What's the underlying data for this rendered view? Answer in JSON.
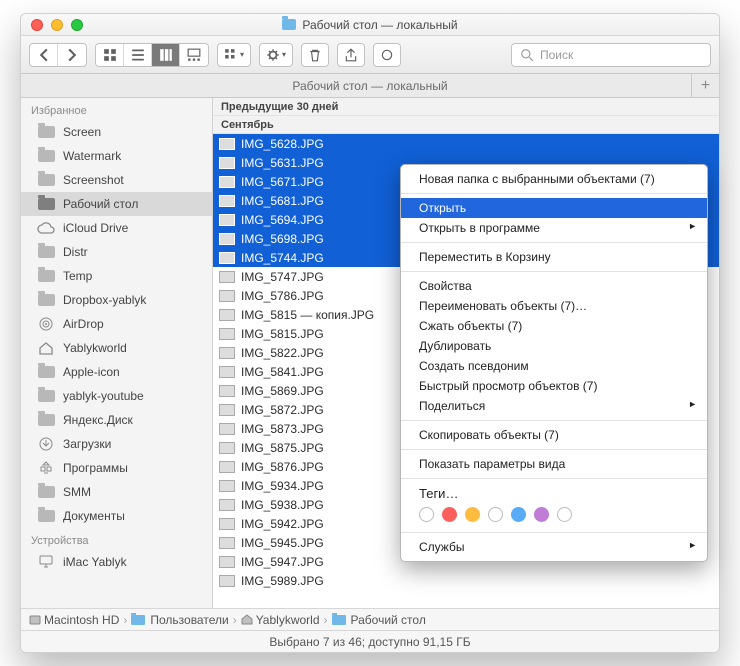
{
  "window": {
    "title": "Рабочий стол — локальный"
  },
  "toolbar": {
    "search_placeholder": "Поиск"
  },
  "tab": {
    "label": "Рабочий стол — локальный"
  },
  "sidebar": {
    "sections": [
      {
        "title": "Избранное",
        "items": [
          {
            "label": "Screen",
            "icon": "folder"
          },
          {
            "label": "Watermark",
            "icon": "folder"
          },
          {
            "label": "Screenshot",
            "icon": "folder"
          },
          {
            "label": "Рабочий стол",
            "icon": "folder-dark",
            "selected": true
          },
          {
            "label": "iCloud Drive",
            "icon": "cloud"
          },
          {
            "label": "Distr",
            "icon": "folder"
          },
          {
            "label": "Temp",
            "icon": "folder"
          },
          {
            "label": "Dropbox-yablyk",
            "icon": "folder"
          },
          {
            "label": "AirDrop",
            "icon": "airdrop"
          },
          {
            "label": "Yablykworld",
            "icon": "home"
          },
          {
            "label": "Apple-icon",
            "icon": "folder"
          },
          {
            "label": "yablyk-youtube",
            "icon": "folder"
          },
          {
            "label": "Яндекс.Диск",
            "icon": "folder"
          },
          {
            "label": "Загрузки",
            "icon": "downloads"
          },
          {
            "label": "Программы",
            "icon": "apps"
          },
          {
            "label": "SMM",
            "icon": "folder"
          },
          {
            "label": "Документы",
            "icon": "folder"
          }
        ]
      },
      {
        "title": "Устройства",
        "items": [
          {
            "label": "iMac Yablyk",
            "icon": "imac"
          }
        ]
      }
    ]
  },
  "content": {
    "groups": [
      "Предыдущие 30 дней",
      "Сентябрь"
    ],
    "files": [
      {
        "name": "IMG_5628.JPG",
        "selected": true
      },
      {
        "name": "IMG_5631.JPG",
        "selected": true
      },
      {
        "name": "IMG_5671.JPG",
        "selected": true
      },
      {
        "name": "IMG_5681.JPG",
        "selected": true
      },
      {
        "name": "IMG_5694.JPG",
        "selected": true
      },
      {
        "name": "IMG_5698.JPG",
        "selected": true
      },
      {
        "name": "IMG_5744.JPG",
        "selected": true
      },
      {
        "name": "IMG_5747.JPG"
      },
      {
        "name": "IMG_5786.JPG"
      },
      {
        "name": "IMG_5815 — копия.JPG"
      },
      {
        "name": "IMG_5815.JPG"
      },
      {
        "name": "IMG_5822.JPG"
      },
      {
        "name": "IMG_5841.JPG"
      },
      {
        "name": "IMG_5869.JPG"
      },
      {
        "name": "IMG_5872.JPG"
      },
      {
        "name": "IMG_5873.JPG"
      },
      {
        "name": "IMG_5875.JPG"
      },
      {
        "name": "IMG_5876.JPG"
      },
      {
        "name": "IMG_5934.JPG"
      },
      {
        "name": "IMG_5938.JPG"
      },
      {
        "name": "IMG_5942.JPG"
      },
      {
        "name": "IMG_5945.JPG"
      },
      {
        "name": "IMG_5947.JPG"
      },
      {
        "name": "IMG_5989.JPG"
      }
    ]
  },
  "context_menu": {
    "items": [
      {
        "label": "Новая папка с выбранными объектами (7)"
      },
      {
        "sep": true
      },
      {
        "label": "Открыть",
        "highlighted": true
      },
      {
        "label": "Открыть в программе",
        "submenu": true
      },
      {
        "sep": true
      },
      {
        "label": "Переместить в Корзину"
      },
      {
        "sep": true
      },
      {
        "label": "Свойства"
      },
      {
        "label": "Переименовать объекты (7)…"
      },
      {
        "label": "Сжать объекты (7)"
      },
      {
        "label": "Дублировать"
      },
      {
        "label": "Создать псевдоним"
      },
      {
        "label": "Быстрый просмотр объектов (7)"
      },
      {
        "label": "Поделиться",
        "submenu": true
      },
      {
        "sep": true
      },
      {
        "label": "Скопировать объекты (7)"
      },
      {
        "sep": true
      },
      {
        "label": "Показать параметры вида"
      },
      {
        "sep": true
      },
      {
        "tags_label": "Теги…"
      },
      {
        "sep": true
      },
      {
        "label": "Службы",
        "submenu": true
      }
    ],
    "tag_colors": [
      "",
      "#fc605c",
      "#fdbc40",
      "",
      "#57acf5",
      "#c07cd6",
      ""
    ]
  },
  "pathbar": {
    "items": [
      {
        "label": "Macintosh HD",
        "icon": "disk"
      },
      {
        "label": "Пользователи",
        "icon": "folder"
      },
      {
        "label": "Yablykworld",
        "icon": "home"
      },
      {
        "label": "Рабочий стол",
        "icon": "folder"
      }
    ]
  },
  "status": {
    "text": "Выбрано 7 из 46; доступно 91,15 ГБ"
  }
}
